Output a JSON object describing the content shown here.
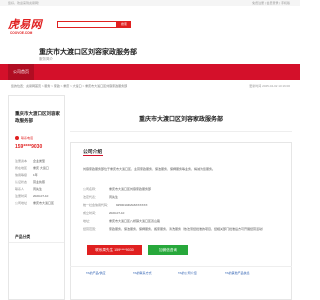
{
  "topbar": {
    "welcome": "您好，欢迎来到虎易网！",
    "right": "免费注册  |  会员登录  |  手机版"
  },
  "logo": {
    "main": "虎易网",
    "sub": "COOVOE.COM"
  },
  "search": {
    "placeholder": "",
    "button_label": "搜索"
  },
  "company": {
    "name": "重庆市大渡口区刘容家政服务部",
    "subtitle": "服务简介"
  },
  "nav": {
    "home_label": "公司首页"
  },
  "breadcrumb": {
    "path": "您的位置：虎易网首页 > 服务 > 家政 > 重庆 > 大渡口 > 重庆市大渡口区刘容家政服务部",
    "time": "更新时间 2025-04-02 10:16:00"
  },
  "sidebar": {
    "title": "重庆市大渡口区刘容家政服务部",
    "phone_label": "联系电话",
    "phone": "159****9030",
    "rows": [
      {
        "k": "注册资本",
        "v": "企业类型"
      },
      {
        "k": "所在地区",
        "v": "重庆 大渡口"
      },
      {
        "k": "信用等级",
        "v": "1年"
      },
      {
        "k": "认证状态",
        "v": "营业执照"
      },
      {
        "k": "联系人",
        "v": "周先生"
      },
      {
        "k": "注册时间",
        "v": "2020-07-10"
      },
      {
        "k": "公司地址",
        "v": "重庆市大渡口区"
      }
    ],
    "products_label": "产品分类"
  },
  "main": {
    "title": "重庆市大渡口区刘容家政服务部",
    "info_title": "公司介绍",
    "intro": "刘容家政服务部位于重庆市大渡口区，主营家政服务、保洁服务、保姆服务等业务，竭诚为您服务。",
    "rows": [
      {
        "k": "公司名称：",
        "v": "重庆市大渡口区刘容家政服务部"
      },
      {
        "k": "法定代表：",
        "v": "周先生"
      },
      {
        "k": "统一社会信用代码：",
        "v": "92500104MA6XXXXXX"
      },
      {
        "k": "成立时间：",
        "v": "2020-07-10"
      },
      {
        "k": "地址：",
        "v": "重庆市大渡口区八桥镇大渡口区双山路"
      },
      {
        "k": "经营范围：",
        "v": "家政服务，保洁服务，保姆服务，搬家服务，清洗服务（依法须经批准的项目，经相关部门批准后方可开展经营活动）"
      }
    ],
    "btn_phone": "联系周先生 159****9030",
    "btn_wechat": "加微信咨询",
    "bottom_links": [
      "TA的产品/供应",
      "TA的联系方式",
      "TA的公司介绍",
      "TA的其他产品信息"
    ]
  }
}
